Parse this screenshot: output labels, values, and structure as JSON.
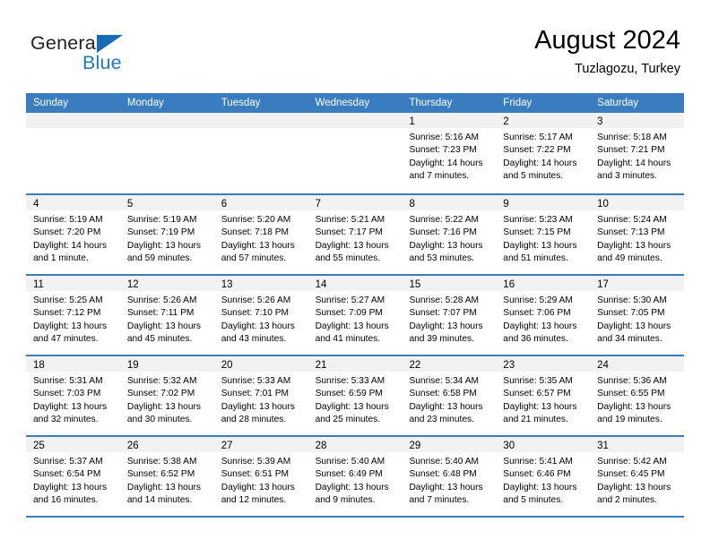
{
  "brand": {
    "name_part1": "General",
    "name_part2": "Blue",
    "triangle_icon": "triangle-icon",
    "color_dark": "#231f20",
    "color_blue": "#1f7bc1"
  },
  "header": {
    "title": "August 2024",
    "subtitle": "Tuzlagozu, Turkey"
  },
  "colors": {
    "header_blue": "#3a7cc0",
    "day_number_band": "#f2f2f2",
    "text": "#000000"
  },
  "weekdays": [
    "Sunday",
    "Monday",
    "Tuesday",
    "Wednesday",
    "Thursday",
    "Friday",
    "Saturday"
  ],
  "weeks": [
    [
      {
        "day": "",
        "lines": []
      },
      {
        "day": "",
        "lines": []
      },
      {
        "day": "",
        "lines": []
      },
      {
        "day": "",
        "lines": []
      },
      {
        "day": "1",
        "lines": [
          "Sunrise: 5:16 AM",
          "Sunset: 7:23 PM",
          "Daylight: 14 hours and 7 minutes."
        ]
      },
      {
        "day": "2",
        "lines": [
          "Sunrise: 5:17 AM",
          "Sunset: 7:22 PM",
          "Daylight: 14 hours and 5 minutes."
        ]
      },
      {
        "day": "3",
        "lines": [
          "Sunrise: 5:18 AM",
          "Sunset: 7:21 PM",
          "Daylight: 14 hours and 3 minutes."
        ]
      }
    ],
    [
      {
        "day": "4",
        "lines": [
          "Sunrise: 5:19 AM",
          "Sunset: 7:20 PM",
          "Daylight: 14 hours and 1 minute."
        ]
      },
      {
        "day": "5",
        "lines": [
          "Sunrise: 5:19 AM",
          "Sunset: 7:19 PM",
          "Daylight: 13 hours and 59 minutes."
        ]
      },
      {
        "day": "6",
        "lines": [
          "Sunrise: 5:20 AM",
          "Sunset: 7:18 PM",
          "Daylight: 13 hours and 57 minutes."
        ]
      },
      {
        "day": "7",
        "lines": [
          "Sunrise: 5:21 AM",
          "Sunset: 7:17 PM",
          "Daylight: 13 hours and 55 minutes."
        ]
      },
      {
        "day": "8",
        "lines": [
          "Sunrise: 5:22 AM",
          "Sunset: 7:16 PM",
          "Daylight: 13 hours and 53 minutes."
        ]
      },
      {
        "day": "9",
        "lines": [
          "Sunrise: 5:23 AM",
          "Sunset: 7:15 PM",
          "Daylight: 13 hours and 51 minutes."
        ]
      },
      {
        "day": "10",
        "lines": [
          "Sunrise: 5:24 AM",
          "Sunset: 7:13 PM",
          "Daylight: 13 hours and 49 minutes."
        ]
      }
    ],
    [
      {
        "day": "11",
        "lines": [
          "Sunrise: 5:25 AM",
          "Sunset: 7:12 PM",
          "Daylight: 13 hours and 47 minutes."
        ]
      },
      {
        "day": "12",
        "lines": [
          "Sunrise: 5:26 AM",
          "Sunset: 7:11 PM",
          "Daylight: 13 hours and 45 minutes."
        ]
      },
      {
        "day": "13",
        "lines": [
          "Sunrise: 5:26 AM",
          "Sunset: 7:10 PM",
          "Daylight: 13 hours and 43 minutes."
        ]
      },
      {
        "day": "14",
        "lines": [
          "Sunrise: 5:27 AM",
          "Sunset: 7:09 PM",
          "Daylight: 13 hours and 41 minutes."
        ]
      },
      {
        "day": "15",
        "lines": [
          "Sunrise: 5:28 AM",
          "Sunset: 7:07 PM",
          "Daylight: 13 hours and 39 minutes."
        ]
      },
      {
        "day": "16",
        "lines": [
          "Sunrise: 5:29 AM",
          "Sunset: 7:06 PM",
          "Daylight: 13 hours and 36 minutes."
        ]
      },
      {
        "day": "17",
        "lines": [
          "Sunrise: 5:30 AM",
          "Sunset: 7:05 PM",
          "Daylight: 13 hours and 34 minutes."
        ]
      }
    ],
    [
      {
        "day": "18",
        "lines": [
          "Sunrise: 5:31 AM",
          "Sunset: 7:03 PM",
          "Daylight: 13 hours and 32 minutes."
        ]
      },
      {
        "day": "19",
        "lines": [
          "Sunrise: 5:32 AM",
          "Sunset: 7:02 PM",
          "Daylight: 13 hours and 30 minutes."
        ]
      },
      {
        "day": "20",
        "lines": [
          "Sunrise: 5:33 AM",
          "Sunset: 7:01 PM",
          "Daylight: 13 hours and 28 minutes."
        ]
      },
      {
        "day": "21",
        "lines": [
          "Sunrise: 5:33 AM",
          "Sunset: 6:59 PM",
          "Daylight: 13 hours and 25 minutes."
        ]
      },
      {
        "day": "22",
        "lines": [
          "Sunrise: 5:34 AM",
          "Sunset: 6:58 PM",
          "Daylight: 13 hours and 23 minutes."
        ]
      },
      {
        "day": "23",
        "lines": [
          "Sunrise: 5:35 AM",
          "Sunset: 6:57 PM",
          "Daylight: 13 hours and 21 minutes."
        ]
      },
      {
        "day": "24",
        "lines": [
          "Sunrise: 5:36 AM",
          "Sunset: 6:55 PM",
          "Daylight: 13 hours and 19 minutes."
        ]
      }
    ],
    [
      {
        "day": "25",
        "lines": [
          "Sunrise: 5:37 AM",
          "Sunset: 6:54 PM",
          "Daylight: 13 hours and 16 minutes."
        ]
      },
      {
        "day": "26",
        "lines": [
          "Sunrise: 5:38 AM",
          "Sunset: 6:52 PM",
          "Daylight: 13 hours and 14 minutes."
        ]
      },
      {
        "day": "27",
        "lines": [
          "Sunrise: 5:39 AM",
          "Sunset: 6:51 PM",
          "Daylight: 13 hours and 12 minutes."
        ]
      },
      {
        "day": "28",
        "lines": [
          "Sunrise: 5:40 AM",
          "Sunset: 6:49 PM",
          "Daylight: 13 hours and 9 minutes."
        ]
      },
      {
        "day": "29",
        "lines": [
          "Sunrise: 5:40 AM",
          "Sunset: 6:48 PM",
          "Daylight: 13 hours and 7 minutes."
        ]
      },
      {
        "day": "30",
        "lines": [
          "Sunrise: 5:41 AM",
          "Sunset: 6:46 PM",
          "Daylight: 13 hours and 5 minutes."
        ]
      },
      {
        "day": "31",
        "lines": [
          "Sunrise: 5:42 AM",
          "Sunset: 6:45 PM",
          "Daylight: 13 hours and 2 minutes."
        ]
      }
    ]
  ]
}
